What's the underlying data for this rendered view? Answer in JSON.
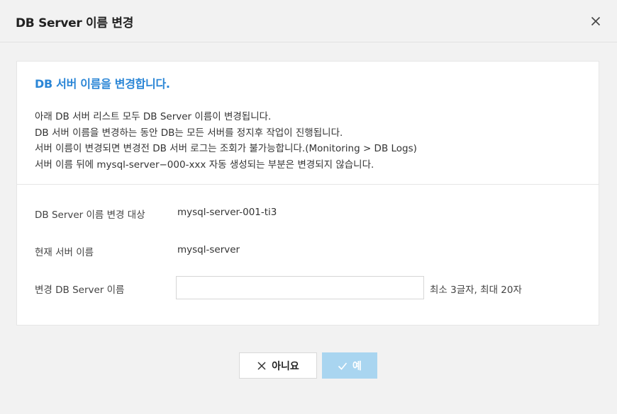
{
  "dialog": {
    "title": "DB Server 이름 변경",
    "close_icon": "close-icon"
  },
  "panel": {
    "heading": "DB 서버 이름을 변경합니다.",
    "notices": [
      "아래 DB 서버 리스트 모두 DB Server 이름이 변경됩니다.",
      "DB 서버 이름을 변경하는 동안 DB는 모든 서버를 정지후 작업이 진행됩니다.",
      "서버 이름이 변경되면 변경전 DB 서버 로그는 조회가 불가능합니다.(Monitoring > DB Logs)",
      "서버 이름 뒤에 mysql-server−000-xxx 자동 생성되는 부분은 변경되지 않습니다."
    ]
  },
  "form": {
    "target_label": "DB Server 이름 변경 대상",
    "target_value": "mysql-server-001-ti3",
    "current_label": "현재 서버 이름",
    "current_value": "mysql-server",
    "new_label": "변경 DB Server 이름",
    "new_value": "",
    "new_placeholder": "",
    "hint": "최소 3글자, 최대 20자"
  },
  "buttons": {
    "no_label": "아니요",
    "no_icon": "close-icon",
    "yes_label": "예",
    "yes_icon": "check-icon"
  },
  "colors": {
    "heading": "#2b86d6",
    "yes_button_bg": "#a9d5f0",
    "background": "#f2f2f2"
  }
}
